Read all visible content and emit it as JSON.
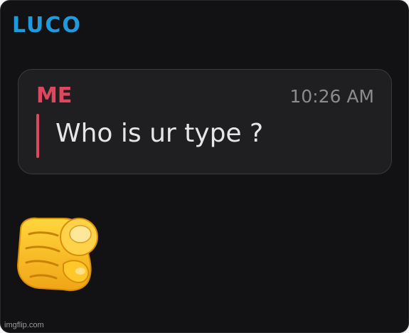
{
  "chat": {
    "sender_name": "LUCO",
    "quoted_message": {
      "author": "ME",
      "time": "10:26 AM",
      "text": "Who is ur type ?"
    },
    "reply_emoji": "👉",
    "reply_emoji_icon": "pointing-at-viewer-emoji"
  },
  "watermark": "imgflip.com",
  "colors": {
    "background": "#121113",
    "sender_name": "#1e9bdc",
    "quote_author": "#e0475e",
    "quote_card": "#1f1f21",
    "quote_text": "#e6e6e6",
    "timestamp": "#8b8b8e"
  }
}
